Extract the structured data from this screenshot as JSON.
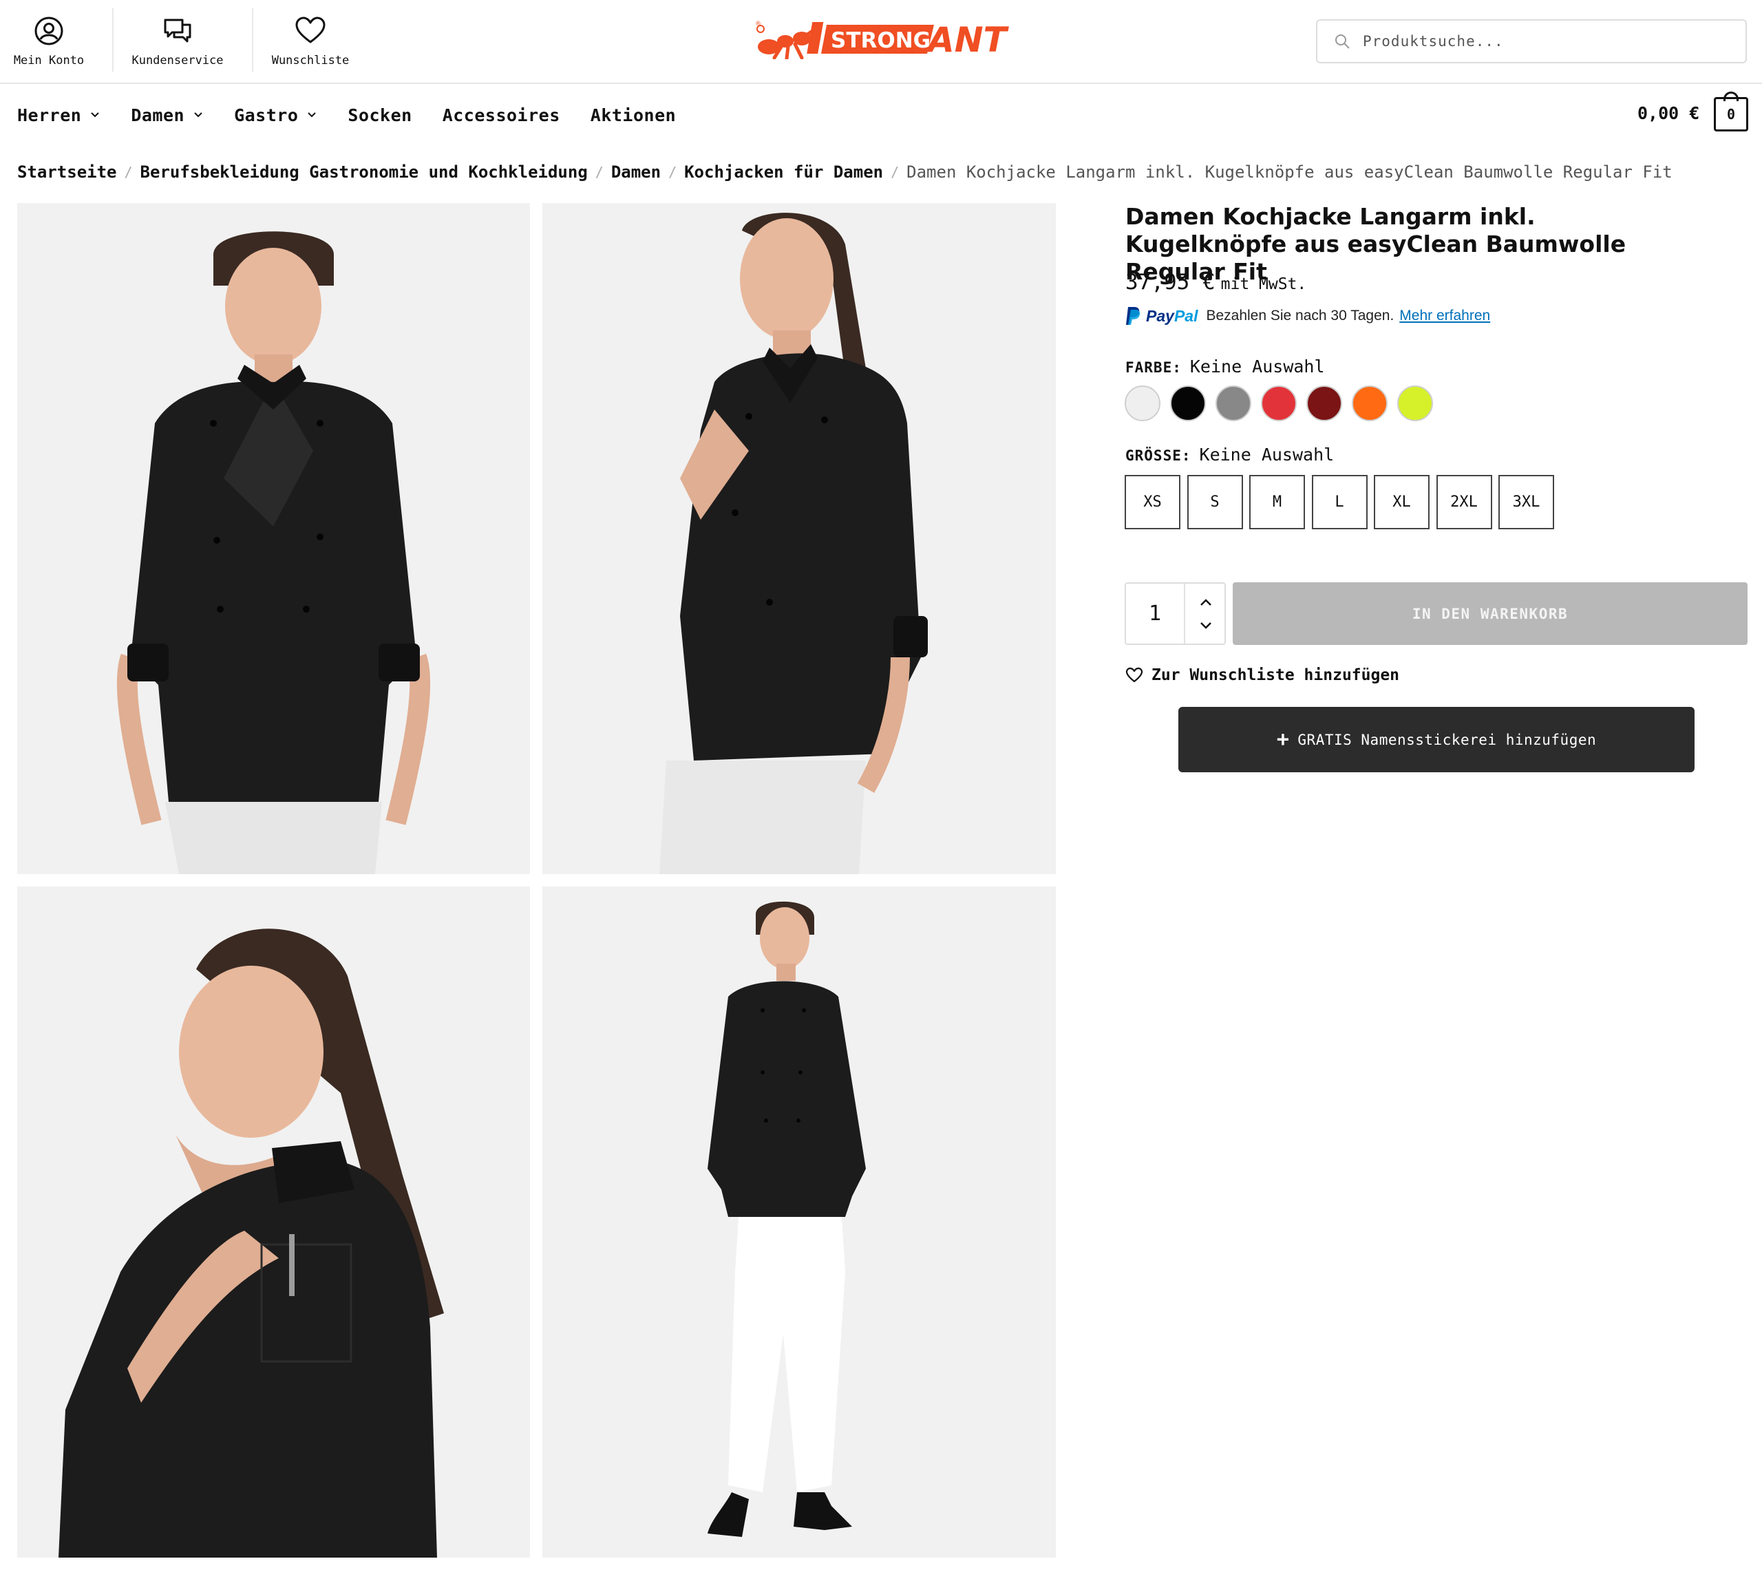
{
  "header": {
    "utility_links": [
      {
        "label": "Mein Konto",
        "icon": "user-circle-icon"
      },
      {
        "label": "Kundenservice",
        "icon": "chat-bubbles-icon"
      },
      {
        "label": "Wunschliste",
        "icon": "heart-icon"
      }
    ],
    "logo": {
      "text_part1": "STRONG",
      "text_part2": "ANT",
      "registered": "®",
      "brand_color": "#f04e23"
    },
    "search": {
      "placeholder": "Produktsuche..."
    }
  },
  "nav": {
    "items": [
      {
        "label": "Herren",
        "has_dropdown": true
      },
      {
        "label": "Damen",
        "has_dropdown": true
      },
      {
        "label": "Gastro",
        "has_dropdown": true
      },
      {
        "label": "Socken",
        "has_dropdown": false
      },
      {
        "label": "Accessoires",
        "has_dropdown": false
      },
      {
        "label": "Aktionen",
        "has_dropdown": false
      }
    ],
    "cart": {
      "total": "0,00 €",
      "count": "0"
    }
  },
  "breadcrumb": {
    "items": [
      "Startseite",
      "Berufsbekleidung Gastronomie und Kochkleidung",
      "Damen",
      "Kochjacken für Damen"
    ],
    "current": "Damen Kochjacke Langarm inkl. Kugelknöpfe aus easyClean Baumwolle Regular Fit",
    "separator": "/"
  },
  "gallery": {
    "images": [
      {
        "name": "product-image-front"
      },
      {
        "name": "product-image-side"
      },
      {
        "name": "product-image-detail"
      },
      {
        "name": "product-image-full"
      }
    ]
  },
  "product": {
    "title": "Damen Kochjacke Langarm inkl. Kugelknöpfe aus easyClean Baumwolle Regular Fit",
    "price": "37,95 €",
    "tax_note": "mit MwSt.",
    "paypal": {
      "brand_a": "Pay",
      "brand_b": "Pal",
      "text": "Bezahlen Sie nach 30 Tagen.",
      "link": "Mehr erfahren"
    },
    "color": {
      "label": "FARBE:",
      "value": "Keine Auswahl",
      "swatches": [
        "#efefef",
        "#050505",
        "#888888",
        "#e3333a",
        "#7b1414",
        "#ff6a13",
        "#d6f02a"
      ]
    },
    "size": {
      "label": "GRÖSSE:",
      "value": "Keine Auswahl",
      "options": [
        "XS",
        "S",
        "M",
        "L",
        "XL",
        "2XL",
        "3XL"
      ]
    },
    "quantity": "1",
    "add_to_cart": "IN DEN WARENKORB",
    "wishlist": "Zur Wunschliste hinzufügen",
    "embroidery_plus": "+",
    "embroidery": "GRATIS Namensstickerei hinzufügen"
  }
}
